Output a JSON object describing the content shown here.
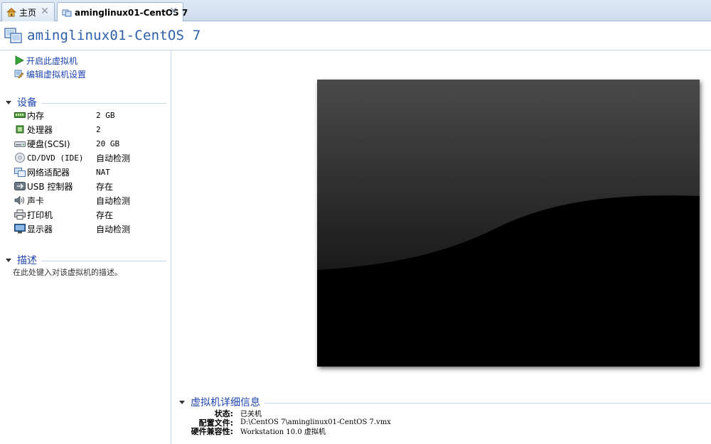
{
  "tabs": [
    {
      "label": "主页",
      "icon": "home-icon"
    },
    {
      "label": "aminglinux01-CentOS 7",
      "icon": "vm-icon",
      "active": true
    }
  ],
  "title": "aminglinux01-CentOS 7",
  "actions": [
    {
      "label": "开启此虚拟机",
      "icon": "play-icon"
    },
    {
      "label": "编辑虚拟机设置",
      "icon": "settings-icon"
    }
  ],
  "devices_section": {
    "label": "设备",
    "items": [
      {
        "name": "内存",
        "value": "2 GB",
        "icon": "memory-icon"
      },
      {
        "name": "处理器",
        "value": "2",
        "icon": "processor-icon"
      },
      {
        "name": "硬盘(SCSI)",
        "value": "20 GB",
        "icon": "harddisk-icon"
      },
      {
        "name": "CD/DVD (IDE)",
        "value": "自动检测",
        "icon": "cd-dvd-icon"
      },
      {
        "name": "网络适配器",
        "value": "NAT",
        "icon": "network-adapter-icon"
      },
      {
        "name": "USB 控制器",
        "value": "存在",
        "icon": "usb-icon"
      },
      {
        "name": "声卡",
        "value": "自动检测",
        "icon": "sound-card-icon"
      },
      {
        "name": "打印机",
        "value": "存在",
        "icon": "printer-icon"
      },
      {
        "name": "显示器",
        "value": "自动检测",
        "icon": "display-icon"
      }
    ]
  },
  "description_section": {
    "label": "描述",
    "placeholder": "在此处键入对该虚拟机的描述。"
  },
  "details_section": {
    "label": "虚拟机详细信息",
    "rows": [
      {
        "key": "状态:",
        "value": "已关机"
      },
      {
        "key": "配置文件:",
        "value": "D:\\CentOS 7\\aminglinux01-CentOS 7.vmx"
      },
      {
        "key": "硬件兼容性:",
        "value": "Workstation 10.0 虚拟机"
      }
    ]
  },
  "colors": {
    "link": "#1f46b0",
    "title": "#2b5fa8",
    "divider": "#c6d4e6"
  }
}
